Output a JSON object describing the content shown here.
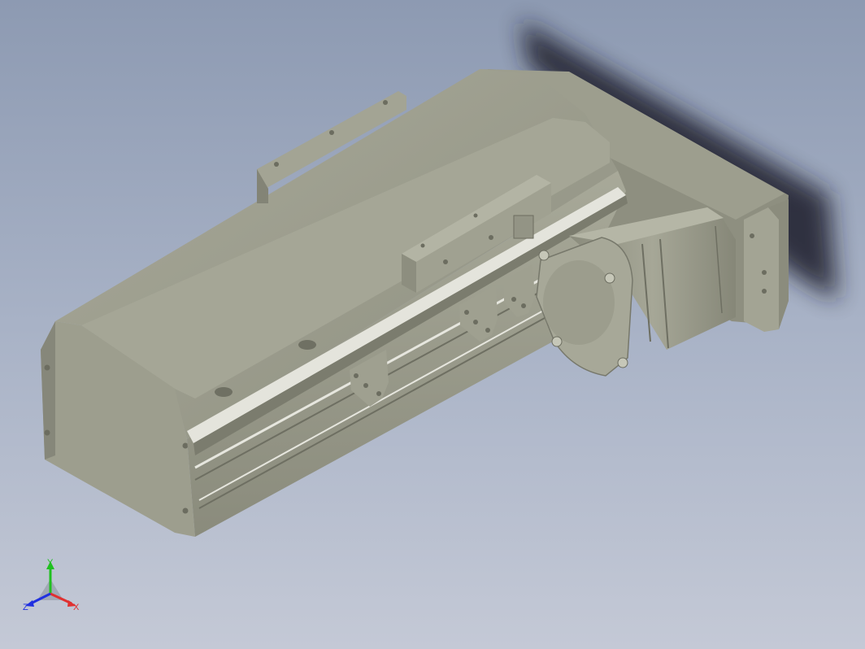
{
  "viewport": {
    "background_top": "#8d9ab2",
    "background_bottom": "#c4c9d6"
  },
  "model": {
    "body_color": "#9b9c8c",
    "face_light": "#b8b9a9",
    "face_mid": "#a2a393",
    "face_dark": "#7a7b6d",
    "rail_color": "#d8d8d0",
    "shadow_color": "#1a1f2a"
  },
  "triad": {
    "x_label": "X",
    "y_label": "Y",
    "z_label": "Z",
    "x_color": "#e03030",
    "y_color": "#20c020",
    "z_color": "#2030e0"
  }
}
